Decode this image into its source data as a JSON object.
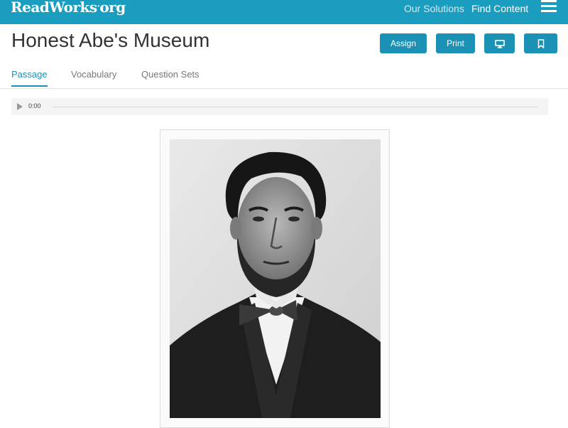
{
  "header": {
    "logo": {
      "name": "ReadWorks",
      "dot": ".",
      "suffix": "org"
    },
    "nav": [
      "Our Solutions",
      "Find Content"
    ],
    "menu_icon": "hamburger-menu-icon",
    "background_color": "#1b9dbf"
  },
  "page": {
    "title": "Honest Abe's Museum",
    "actions": {
      "assign": "Assign",
      "print": "Print",
      "present_icon": "monitor-icon",
      "bookmark_icon": "bookmark-icon"
    }
  },
  "tabs": [
    {
      "label": "Passage",
      "active": true
    },
    {
      "label": "Vocabulary",
      "active": false
    },
    {
      "label": "Question Sets",
      "active": false
    }
  ],
  "audio": {
    "time": "0:00",
    "progress": 0,
    "play_icon": "play-icon"
  },
  "media": {
    "image": "portrait-photo",
    "description_icon": "abraham-lincoln-portrait"
  },
  "colors": {
    "accent": "#1b92b5",
    "title": "#333333",
    "tab_inactive": "#777777"
  }
}
